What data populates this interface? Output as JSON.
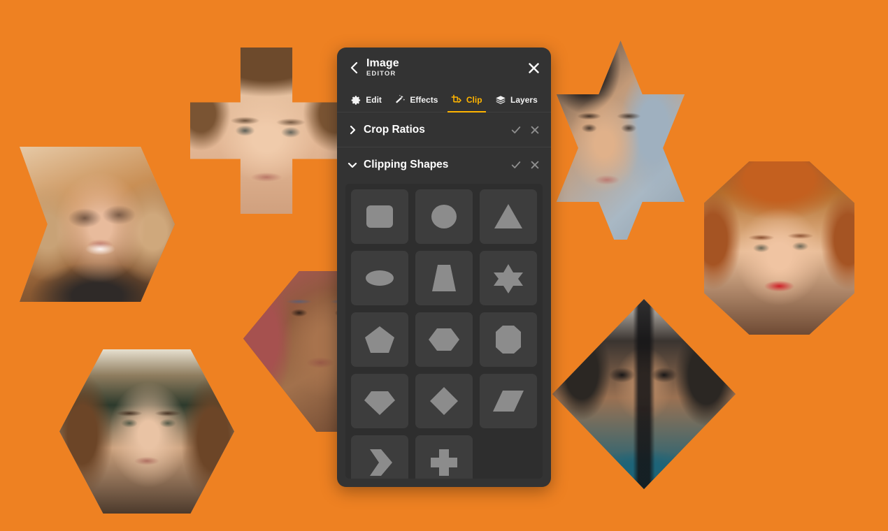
{
  "theme": {
    "background_color": "#ee8122",
    "panel_color": "#333333",
    "accent_color": "#ffb400",
    "tile_color": "#3d3d3d",
    "shape_color": "#8c8c8c",
    "grid_bg_color": "#2e2e2e"
  },
  "panel": {
    "title": "Image",
    "subtitle": "EDITOR",
    "back_icon": "chevron-left-icon",
    "close_icon": "close-icon"
  },
  "tabs": [
    {
      "label": "Edit",
      "icon": "gear-icon",
      "active": false
    },
    {
      "label": "Effects",
      "icon": "magic-wand-icon",
      "active": false
    },
    {
      "label": "Clip",
      "icon": "crop-icon",
      "active": true
    },
    {
      "label": "Layers",
      "icon": "layers-icon",
      "active": false
    }
  ],
  "sections": [
    {
      "title": "Crop Ratios",
      "expanded": false,
      "caret_icon": "chevron-right-icon",
      "confirm_icon": "check-icon",
      "cancel_icon": "close-icon"
    },
    {
      "title": "Clipping Shapes",
      "expanded": true,
      "caret_icon": "chevron-down-icon",
      "confirm_icon": "check-icon",
      "cancel_icon": "close-icon"
    }
  ],
  "clipping_shapes": [
    {
      "name": "rounded-square",
      "label": "Rounded Square"
    },
    {
      "name": "circle",
      "label": "Circle"
    },
    {
      "name": "triangle",
      "label": "Triangle"
    },
    {
      "name": "ellipse",
      "label": "Ellipse"
    },
    {
      "name": "trapezoid",
      "label": "Trapezoid"
    },
    {
      "name": "star-6",
      "label": "Six Point Star"
    },
    {
      "name": "pentagon",
      "label": "Pentagon"
    },
    {
      "name": "hexagon",
      "label": "Hexagon"
    },
    {
      "name": "octagon",
      "label": "Octagon"
    },
    {
      "name": "gem",
      "label": "Gem"
    },
    {
      "name": "diamond",
      "label": "Diamond"
    },
    {
      "name": "parallelogram",
      "label": "Parallelogram"
    },
    {
      "name": "chevron",
      "label": "Chevron"
    },
    {
      "name": "cross",
      "label": "Cross"
    }
  ],
  "canvas_images": [
    {
      "name": "portrait-chevron",
      "clip": "chevron",
      "alt": "Smiling blonde woman portrait clipped to a chevron"
    },
    {
      "name": "portrait-cross",
      "clip": "cross",
      "alt": "Young man portrait clipped to a cross"
    },
    {
      "name": "portrait-star",
      "clip": "star-6",
      "alt": "Smiling man portrait clipped to a six point star"
    },
    {
      "name": "portrait-octagon",
      "clip": "octagon",
      "alt": "Red haired woman portrait clipped to an octagon"
    },
    {
      "name": "portrait-hexagon",
      "clip": "hexagon",
      "alt": "Woman portrait clipped to a hexagon"
    },
    {
      "name": "portrait-pentagon",
      "clip": "pentagon",
      "alt": "Woman portrait clipped behind the panel"
    },
    {
      "name": "portrait-diamond",
      "clip": "diamond",
      "alt": "Man with sunglasses portrait clipped to a diamond"
    }
  ]
}
